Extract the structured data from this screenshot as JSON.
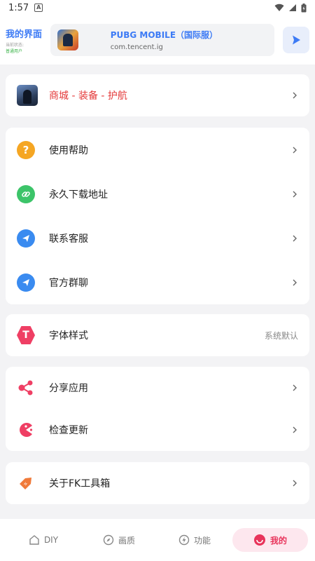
{
  "status": {
    "time": "1:57",
    "notif_letter": "A"
  },
  "header": {
    "title": "我的界面",
    "sub1": "当前状态:",
    "sub2": "普通用户",
    "game_name": "PUBG MOBILE（国际服）",
    "game_package": "com.tencent.ig"
  },
  "menu": {
    "shop": {
      "label": "商城 - 装备 - 护航"
    },
    "help": {
      "label": "使用帮助"
    },
    "download": {
      "label": "永久下载地址"
    },
    "service": {
      "label": "联系客服"
    },
    "group": {
      "label": "官方群聊"
    },
    "font": {
      "label": "字体样式",
      "value": "系统默认"
    },
    "share": {
      "label": "分享应用"
    },
    "update": {
      "label": "检查更新"
    },
    "about": {
      "label": "关于FK工具箱"
    }
  },
  "nav": {
    "items": [
      {
        "label": "DIY",
        "icon": "home-icon"
      },
      {
        "label": "画质",
        "icon": "compass-icon"
      },
      {
        "label": "功能",
        "icon": "lightning-icon"
      },
      {
        "label": "我的",
        "icon": "smile-icon"
      }
    ],
    "active_index": 3
  },
  "colors": {
    "accent": "#3d7bf5",
    "danger": "#e43a3a",
    "active_nav": "#e8345b",
    "help_icon": "#f5a623",
    "link_icon": "#3cc469",
    "telegram_icon": "#3a8bf0",
    "font_icon": "#ef3f64",
    "share_icon": "#ef3f64",
    "update_icon": "#ef3f64",
    "about_icon": "#f07a3a"
  }
}
